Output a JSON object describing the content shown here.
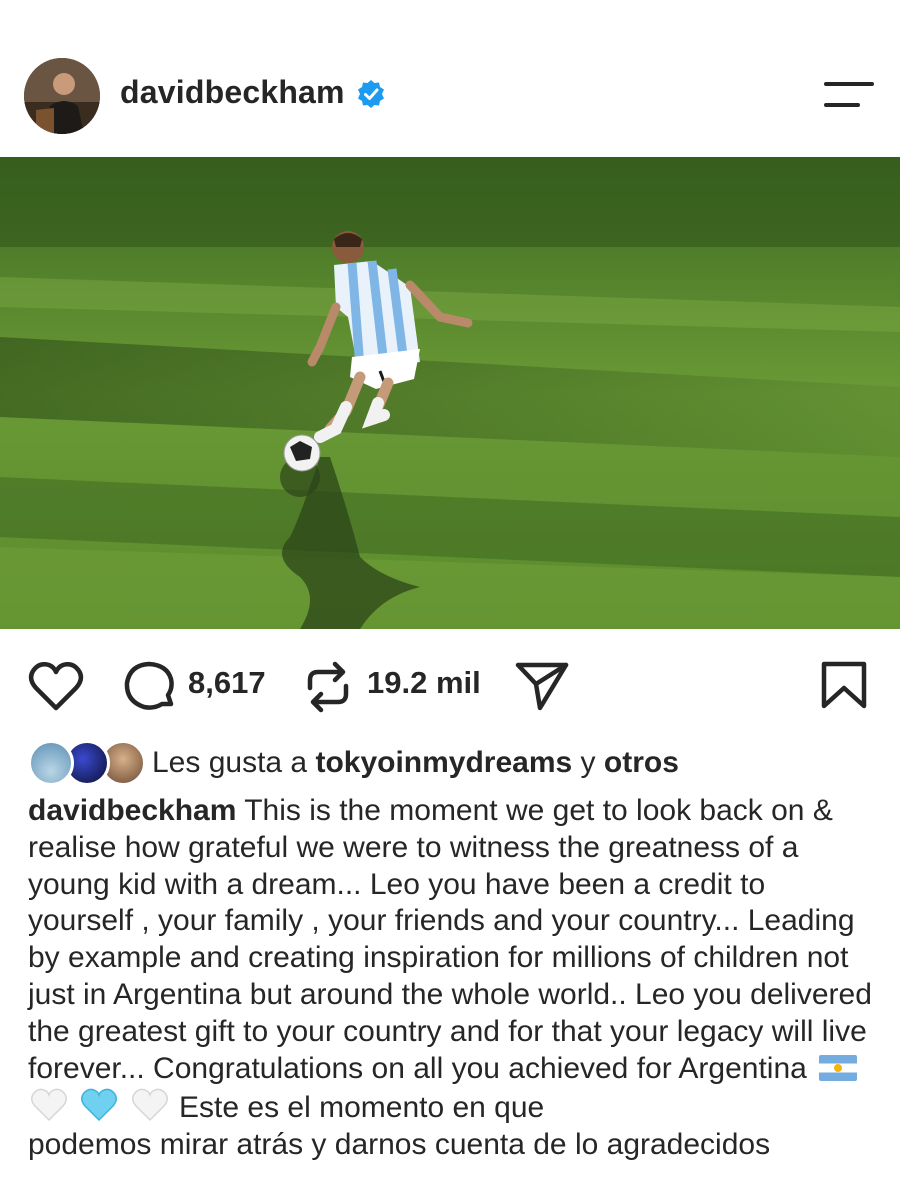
{
  "header": {
    "username": "davidbeckham"
  },
  "actions": {
    "comments_count": "8,617",
    "reposts_count": "19.2 mil"
  },
  "likes": {
    "prefix": "Les gusta a ",
    "user": "tokyoinmydreams",
    "middle": " y ",
    "others": "otros"
  },
  "caption": {
    "username": "davidbeckham",
    "text": " This is the moment we get to look back on & realise how grateful we were to witness the greatness of a young kid with a dream... Leo you have been a credit to yourself , your family , your friends and your country... Leading by example and creating inspiration for millions of children not just in Argentina but around the whole world.. Leo you delivered the greatest gift to your country and for that your legacy will live forever... Congratulations on all you achieved for Argentina",
    "after_emojis": " Este es el momento en que",
    "next_line_partial": "podemos mirar atrás y darnos cuenta de lo agradecidos"
  },
  "colors": {
    "verified": "#1d9bf0",
    "text": "#262626",
    "grass": "#5f8a2f"
  }
}
